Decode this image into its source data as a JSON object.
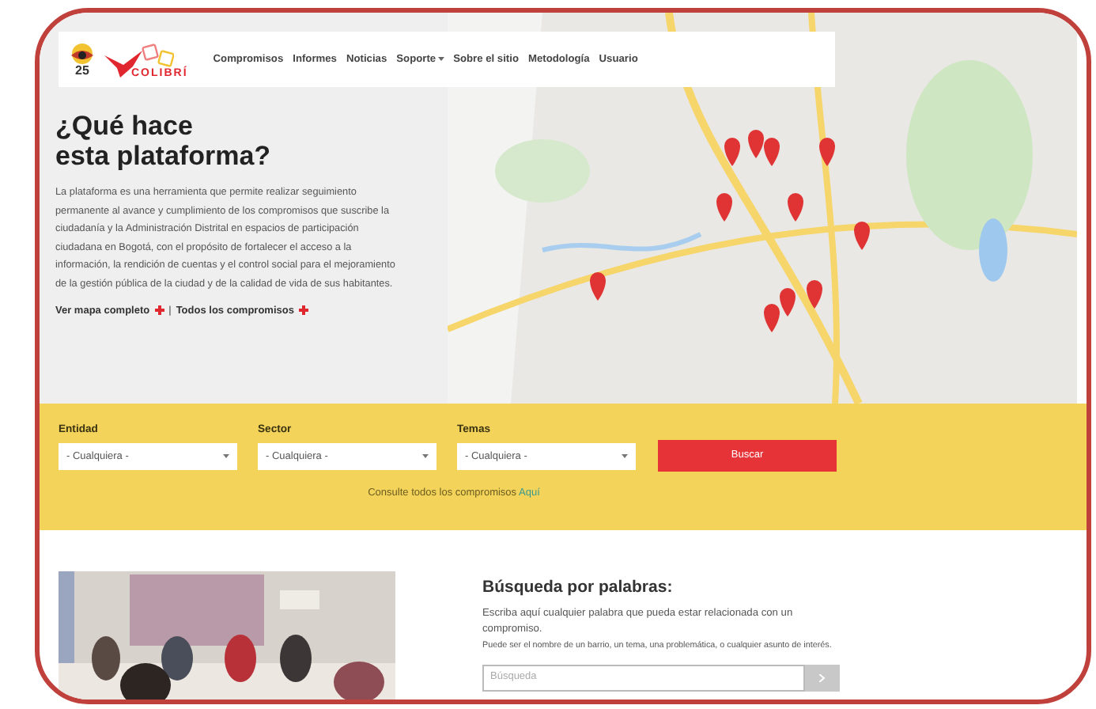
{
  "nav": {
    "badge": "25",
    "brand": "COLIBRÍ",
    "items": [
      {
        "label": "Compromisos",
        "dropdown": false
      },
      {
        "label": "Informes",
        "dropdown": false
      },
      {
        "label": "Noticias",
        "dropdown": false
      },
      {
        "label": "Soporte",
        "dropdown": true
      },
      {
        "label": "Sobre el sitio",
        "dropdown": false
      },
      {
        "label": "Metodología",
        "dropdown": false
      },
      {
        "label": "Usuario",
        "dropdown": false
      }
    ]
  },
  "intro": {
    "title_lines": [
      "¿Qué hace",
      "esta plataforma?"
    ],
    "body": "La plataforma es una herramienta que permite realizar seguimiento permanente al avance y cumplimiento de los compromisos que suscribe la ciudadanía y la Administración Distrital en espacios de participación ciudadana en Bogotá, con el propósito de fortalecer el acceso a la información, la rendición de cuentas y el control social para el mejoramiento de la gestión pública de la ciudad y de la calidad de vida de sus habitantes.",
    "links": [
      "Ver mapa completo",
      "Todos los compromisos"
    ],
    "separator": "|"
  },
  "filters": {
    "fields": [
      {
        "label": "Entidad",
        "value": "- Cualquiera -"
      },
      {
        "label": "Sector",
        "value": "- Cualquiera -"
      },
      {
        "label": "Temas",
        "value": "- Cualquiera -"
      }
    ],
    "button": "Buscar",
    "footer_text": "Consulte todos los compromisos",
    "footer_link": "Aquí"
  },
  "word_search": {
    "title": "Búsqueda por palabras:",
    "description": "Escriba aquí cualquier palabra que pueda estar relacionada con un compromiso.",
    "hint": "Puede ser el nombre de un barrio, un tema, una problemática, o cualquier asunto de interés.",
    "placeholder": "Búsqueda"
  }
}
